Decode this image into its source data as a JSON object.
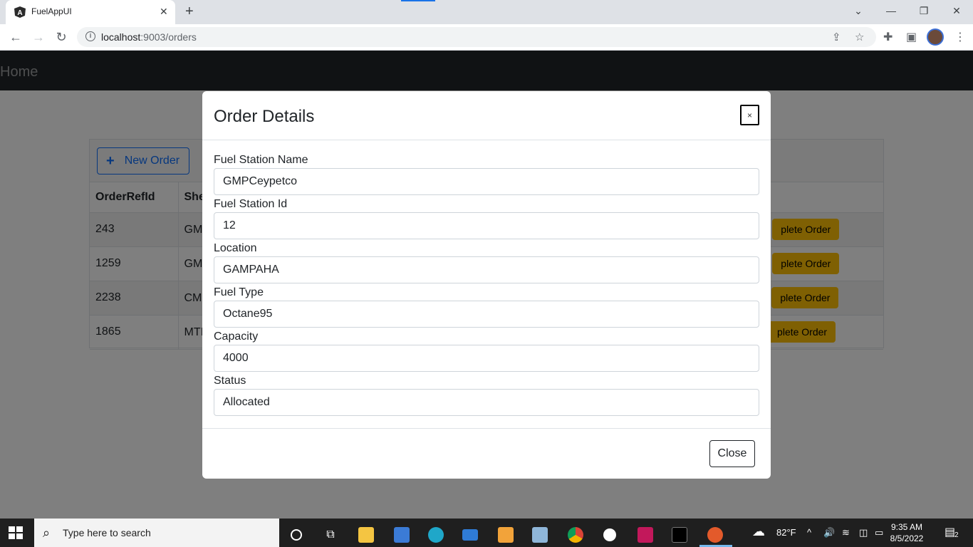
{
  "browser": {
    "tab_title": "FuelAppUI",
    "tab_close": "✕",
    "new_tab": "+",
    "url_host": "localhost",
    "url_rest": ":9003/orders"
  },
  "navbar": {
    "brand": "Home"
  },
  "orders": {
    "new_order_label": "New Order",
    "columns": [
      "OrderRefId",
      "She"
    ],
    "rows": [
      {
        "id": "243",
        "partial": "GM",
        "action": "plete Order"
      },
      {
        "id": "1259",
        "partial": "GM",
        "action": "plete Order"
      },
      {
        "id": "2238",
        "partial": "CM",
        "action": "plete Order"
      },
      {
        "id": "1865",
        "partial": "MTI",
        "action": "plete Order"
      }
    ]
  },
  "modal": {
    "title": "Order Details",
    "close_x": "×",
    "fields": [
      {
        "label": "Fuel Station Name",
        "value": "GMPCeypetco"
      },
      {
        "label": "Fuel Station Id",
        "value": "12"
      },
      {
        "label": "Location",
        "value": "GAMPAHA"
      },
      {
        "label": "Fuel Type",
        "value": "Octane95"
      },
      {
        "label": "Capacity",
        "value": "4000"
      },
      {
        "label": "Status",
        "value": "Allocated"
      }
    ],
    "close_label": "Close"
  },
  "taskbar": {
    "search_placeholder": "Type here to search",
    "weather": "82°F",
    "time": "9:35 AM",
    "date": "8/5/2022",
    "notifications": "2"
  },
  "colors": {
    "navbar_bg": "#212529",
    "primary": "#0d6efd",
    "warning": "#ffc107",
    "taskbar_bg": "#1f1f1f"
  }
}
